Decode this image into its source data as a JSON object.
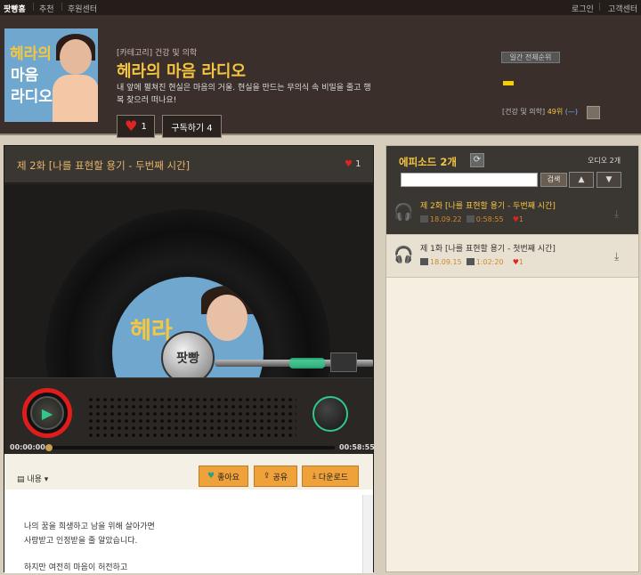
{
  "topnav": {
    "home": "팟빵홈",
    "recommend": "추천",
    "support": "후원센터",
    "login": "로그인",
    "customer": "고객센터"
  },
  "channel": {
    "thumb_line1": "헤라의",
    "thumb_line2": "마음",
    "thumb_line3": "라디오",
    "category": "[카테고리] 건강 및 의학",
    "title": "헤라의 마음 라디오",
    "description": "내 앞에 펼쳐진 현실은 마음의 거울. 현실을 만드는 무의식 속 비밀을 줄고 행복 찾으러 떠나요!",
    "likes": "1",
    "subscribe": "구독하기 4"
  },
  "rank": {
    "badge": "일간 전체순위",
    "category": "[건강 및 의학]",
    "position": "49위",
    "trend": "(—)"
  },
  "player": {
    "episode_title": "제 2화 [나를 표현할 용기 - 두번째 시간]",
    "episode_likes": "1",
    "knob_label": "팟빵",
    "label_text": "헤라",
    "time_current": "00:00:00",
    "time_total": "00:58:55",
    "progress": 0,
    "menu_label": "내용 ▾",
    "like_btn": "좋아요",
    "share_btn": "공유",
    "download_btn": "다운로드",
    "content_line1": "나의 꿈을 희생하고 남을 위해 살아가면",
    "content_line2": "사랑받고 인정받을 줄 알았습니다.",
    "content_line3": "하지만 여전히 마음이 허전하고"
  },
  "episodes": {
    "count_label": "에피소드 2개",
    "audio_count": "오디오 2개",
    "search_placeholder": "",
    "search_btn": "검색",
    "up": "▲",
    "down": "▼",
    "items": [
      {
        "title": "제 2화 [나를 표현할 용기 - 두번째 시간]",
        "date": "18.09.22",
        "duration": "0:58:55",
        "likes": "1",
        "active": true
      },
      {
        "title": "제 1화 [나를 표현할 용기 - 첫번째 시간]",
        "date": "18.09.15",
        "duration": "1:02:20",
        "likes": "1",
        "active": false
      }
    ]
  },
  "colors": {
    "accent": "#f5c542",
    "play_ring": "#e01c1c",
    "button": "#f0a23a",
    "green": "#2fc98c"
  }
}
